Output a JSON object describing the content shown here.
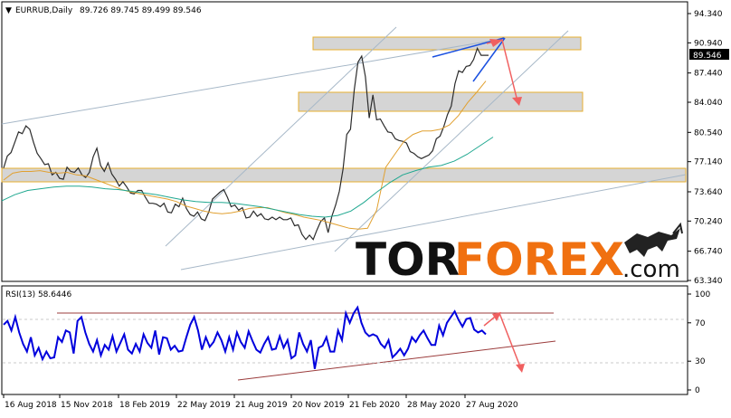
{
  "chart_data": {
    "type": "line",
    "symbol": "EURRUB,Daily",
    "ohlc": "89.726 89.745 89.499 89.546",
    "last_price": "89.546",
    "price_ticks": [
      "94.340",
      "90.940",
      "87.440",
      "84.040",
      "80.540",
      "77.140",
      "73.640",
      "70.240",
      "66.740",
      "63.340"
    ],
    "price_ylim": [
      63.34,
      94.34
    ],
    "x_ticks": [
      "16 Aug 2018",
      "15 Nov 2018",
      "18 Feb 2019",
      "22 May 2019",
      "21 Aug 2019",
      "20 Nov 2019",
      "21 Feb 2020",
      "28 May 2020",
      "27 Aug 2020"
    ],
    "series": [
      {
        "values": [
          76.4,
          77.8,
          78.2,
          79.4,
          80.6,
          80.4,
          81.3,
          80.9,
          79.4,
          78.1,
          77.5,
          76.8,
          76.9,
          75.6,
          75.9,
          75.2,
          75.1,
          76.5,
          76.0,
          75.9,
          76.4,
          75.6,
          75.3,
          75.9,
          77.7,
          78.7,
          76.7,
          76.0,
          77.0,
          75.7,
          75.1,
          74.3,
          74.8,
          74.2,
          73.5,
          73.4,
          73.8,
          73.8,
          73.0,
          72.3,
          72.3,
          72.2,
          71.9,
          72.3,
          71.3,
          71.2,
          72.2,
          71.9,
          72.9,
          71.7,
          71.0,
          70.8,
          71.3,
          70.5,
          70.3,
          71.3,
          72.8,
          73.2,
          73.6,
          73.9,
          73.0,
          71.9,
          72.1,
          71.5,
          71.8,
          70.6,
          70.7,
          71.4,
          70.8,
          71.1,
          70.5,
          70.4,
          70.7,
          70.4,
          70.7,
          70.4,
          70.4,
          70.6,
          69.7,
          69.8,
          68.7,
          68.1,
          68.6,
          68.1,
          69.2,
          70.2,
          70.6,
          68.9,
          70.8,
          72.1,
          73.7,
          76.3,
          80.3,
          80.9,
          85.5,
          88.7,
          89.4,
          87.0,
          82.2,
          84.9,
          82.0,
          82.1,
          81.3,
          80.6,
          80.5,
          79.8,
          79.6,
          79.5,
          79.3,
          78.3,
          78.1,
          77.7,
          77.5,
          77.7,
          77.9,
          78.4,
          79.8,
          80.1,
          81.2,
          82.6,
          83.6,
          86.2,
          87.7,
          87.5,
          88.2,
          88.3,
          89.0,
          90.3,
          89.5,
          89.5,
          89.5
        ],
        "color": "#2c2c2c"
      },
      {
        "values": [
          75.0,
          75.8,
          76.0,
          76.0,
          76.1,
          75.9,
          75.8,
          75.9,
          75.6,
          75.5,
          75.1,
          74.7,
          74.3,
          73.9,
          73.6,
          73.4,
          73.2,
          73.0,
          72.8,
          72.5,
          72.0,
          71.7,
          71.4,
          71.2,
          71.1,
          71.2,
          71.4,
          71.7,
          71.8,
          71.8,
          71.5,
          71.2,
          71.0,
          70.7,
          70.5,
          70.3,
          70.0,
          69.7,
          69.4,
          69.3,
          69.4,
          71.5,
          76.5,
          78.0,
          79.5,
          80.3,
          80.7,
          80.7,
          80.9,
          81.4,
          82.5,
          84.0,
          85.2,
          86.5
        ],
        "color": "#e1a030"
      },
      {
        "values": [
          72.6,
          73.3,
          73.8,
          74.0,
          74.2,
          74.3,
          74.3,
          74.2,
          74.0,
          73.9,
          73.7,
          73.5,
          73.3,
          73.0,
          72.7,
          72.5,
          72.4,
          72.4,
          72.3,
          72.1,
          71.9,
          71.6,
          71.3,
          71.0,
          70.8,
          70.7,
          70.9,
          71.4,
          72.4,
          73.6,
          74.7,
          75.6,
          76.1,
          76.5,
          76.7,
          77.2,
          78.0,
          79.0,
          80.0
        ],
        "color": "#20a890"
      }
    ],
    "rsi": {
      "label": "RSI(13) 58.6446",
      "ticks": [
        "100",
        "70",
        "30",
        "0"
      ],
      "ylim": [
        0,
        100
      ],
      "levels": [
        70,
        30
      ],
      "values": [
        68,
        72,
        62,
        76,
        60,
        48,
        40,
        55,
        36,
        44,
        32,
        40,
        33,
        34,
        55,
        50,
        62,
        60,
        38,
        72,
        76,
        60,
        48,
        40,
        52,
        36,
        47,
        42,
        56,
        40,
        49,
        58,
        42,
        38,
        48,
        40,
        58,
        49,
        44,
        62,
        37,
        55,
        54,
        42,
        46,
        40,
        41,
        55,
        68,
        76,
        62,
        42,
        55,
        45,
        50,
        60,
        52,
        40,
        55,
        42,
        60,
        50,
        44,
        61,
        51,
        42,
        39,
        48,
        55,
        42,
        43,
        56,
        44,
        52,
        33,
        36,
        60,
        48,
        40,
        52,
        22,
        44,
        46,
        55,
        40,
        40,
        62,
        52,
        80,
        70,
        80,
        86,
        70,
        60,
        56,
        58,
        56,
        48,
        44,
        52,
        34,
        38,
        43,
        36,
        43,
        55,
        50,
        57,
        62,
        54,
        47,
        47,
        67,
        57,
        70,
        76,
        82,
        73,
        66,
        74,
        75,
        63,
        60,
        62,
        58
      ],
      "color": "#0000dd"
    },
    "watermark": {
      "part1": "TOR",
      "part2": "FOREX",
      "suffix": ".com"
    },
    "colors": {
      "bull_line": "#1a50e0",
      "arrow": "#f06060",
      "zone_fill": "#d5d5d5",
      "zone_border": "#e8b030",
      "channel": "#a7b8c8",
      "rsi_line_brown": "#9b3c3c"
    }
  }
}
